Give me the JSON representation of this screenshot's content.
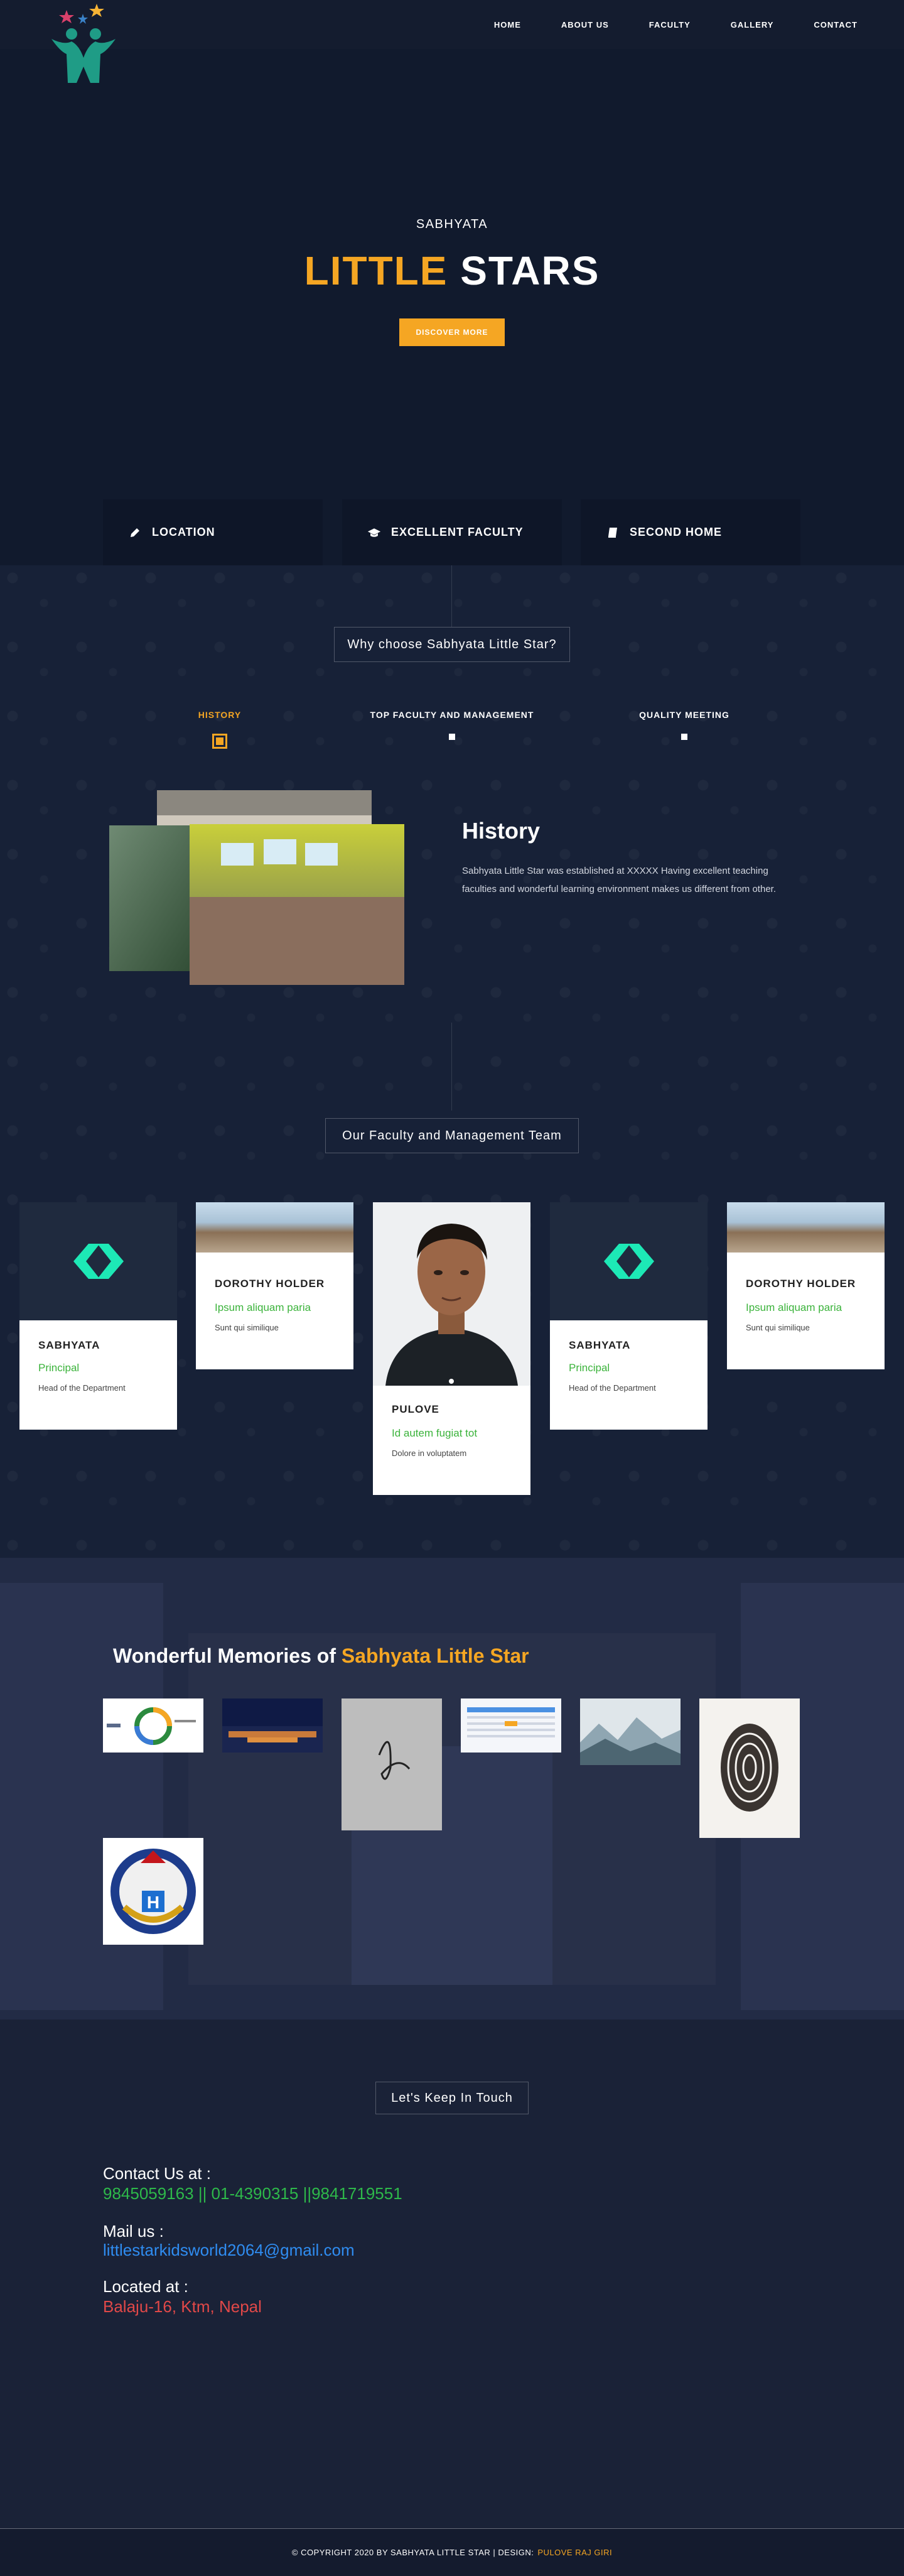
{
  "nav": {
    "links": [
      "HOME",
      "ABOUT US",
      "FACULTY",
      "GALLERY",
      "CONTACT"
    ]
  },
  "hero": {
    "subtitle": "SABHYATA",
    "title_highlight": "LITTLE",
    "title_rest": "STARS",
    "button_label": "DISCOVER MORE"
  },
  "features": [
    {
      "icon": "pencil-icon",
      "label": "LOCATION"
    },
    {
      "icon": "graduation-cap-icon",
      "label": "EXCELLENT FACULTY"
    },
    {
      "icon": "book-icon",
      "label": "SECOND HOME"
    }
  ],
  "why": {
    "heading": "Why choose Sabhyata Little Star?",
    "tabs": [
      "HISTORY",
      "TOP FACULTY AND MANAGEMENT",
      "QUALITY MEETING"
    ],
    "active_tab": 0,
    "history_title": "History",
    "history_text": "Sabhyata Little Star was established at XXXXX Having excellent teaching faculties and wonderful learning environment makes us different from other."
  },
  "team": {
    "heading": "Our Faculty and Management Team",
    "members": [
      {
        "name": "SABHYATA",
        "role": "Principal",
        "desc": "Head of the Department",
        "image": "code-logo-icon"
      },
      {
        "name": "DOROTHY HOLDER",
        "role": "Ipsum aliquam paria",
        "desc": "Sunt qui similique",
        "image": "school-building-photo"
      },
      {
        "name": "PULOVE",
        "role": "Id autem fugiat tot",
        "desc": "Dolore in voluptatem",
        "image": "portrait-photo"
      },
      {
        "name": "SABHYATA",
        "role": "Principal",
        "desc": "Head of the Department",
        "image": "code-logo-icon"
      },
      {
        "name": "DOROTHY HOLDER",
        "role": "Ipsum aliquam paria",
        "desc": "Sunt qui similique",
        "image": "school-building-photo"
      }
    ]
  },
  "memories": {
    "title_prefix": "Wonderful Memories of",
    "title_highlight": "Sabhyata Little Star",
    "thumbnails": [
      "logo-chart-thumb",
      "night-city-thumb",
      "signature-thumb",
      "calendar-screenshot-thumb",
      "misty-mountain-thumb",
      "fingerprint-thumb",
      "nepal-police-emblem-thumb"
    ]
  },
  "contact": {
    "heading": "Let's Keep In Touch",
    "contact_label": "Contact Us at :",
    "phones": "9845059163 || 01-4390315 ||9841719551",
    "mail_label": "Mail us :",
    "email": "littlestarkidsworld2064@gmail.com",
    "location_label": "Located at :",
    "location": "Balaju-16, Ktm, Nepal",
    "colors": {
      "phones": "#2eb84a",
      "email": "#2f8cf0",
      "location": "#e04848"
    }
  },
  "footer": {
    "copyright": "© COPYRIGHT 2020 BY SABHYATA LITTLE STAR | DESIGN:",
    "designer": "PULOVE RAJ GIRI"
  }
}
